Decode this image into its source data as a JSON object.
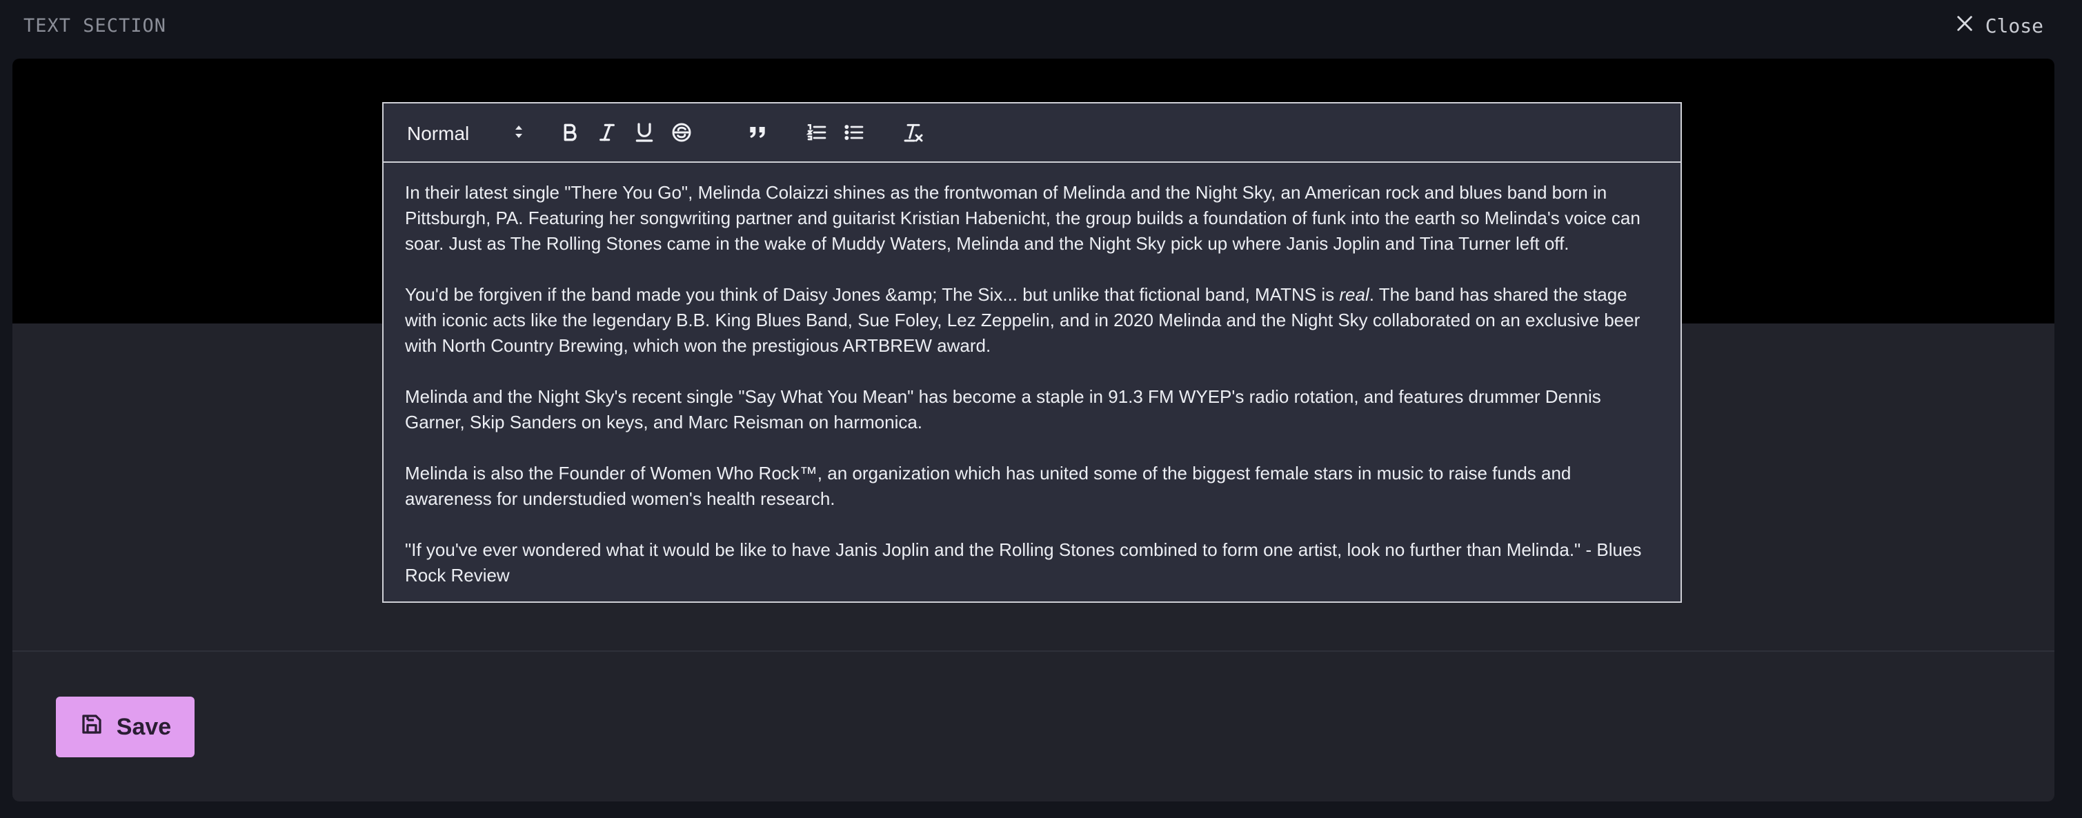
{
  "header": {
    "title": "TEXT SECTION",
    "close_label": "Close",
    "close_icon": "close-icon"
  },
  "editor": {
    "format_select": {
      "selected": "Normal",
      "icon": "select-arrows-icon"
    },
    "toolbar_icons": [
      "bold-icon",
      "italic-icon",
      "underline-icon",
      "strikethrough-icon",
      "blockquote-icon",
      "ordered-list-icon",
      "bullet-list-icon",
      "clear-format-icon"
    ],
    "paragraphs": [
      {
        "text": "In their latest single \"There You Go\", Melinda Colaizzi shines as the frontwoman of Melinda and the Night Sky, an American rock and blues band born in Pittsburgh, PA. Featuring her songwriting partner and guitarist Kristian Habenicht, the group builds a foundation of funk into the earth so Melinda's voice can soar. Just as The Rolling Stones came in the wake of Muddy Waters, Melinda and the Night Sky pick up where Janis Joplin and Tina Turner left off."
      },
      {
        "before": "You'd be forgiven if the band made you think of Daisy Jones &amp; The Six... but unlike that fictional band, MATNS is ",
        "em": "real",
        "after": ". The band has shared the stage with iconic acts like the legendary B.B. King Blues Band, Sue Foley, Lez Zeppelin, and in 2020 Melinda and the Night Sky collaborated on an exclusive beer with North Country Brewing, which won the prestigious ARTBREW award."
      },
      {
        "text": "Melinda and the Night Sky's recent single \"Say What You Mean\" has become a staple in 91.3 FM WYEP's radio rotation, and features drummer Dennis Garner, Skip Sanders on keys, and Marc Reisman on harmonica."
      },
      {
        "text": "Melinda is also the Founder of Women Who Rock™, an organization which has united some of the biggest female stars in music to raise funds and awareness for understudied women's health research."
      },
      {
        "text": "\"If you've ever wondered what it would be like to have Janis Joplin and the Rolling Stones combined to form one artist, look no further than Melinda.\" - Blues Rock Review"
      }
    ]
  },
  "footer": {
    "save_label": "Save",
    "save_icon": "save-icon"
  },
  "colors": {
    "accent": "#e19ef0",
    "panel": "#22232b",
    "editor_bg": "#2c2e3b",
    "page_bg": "#13151c"
  }
}
